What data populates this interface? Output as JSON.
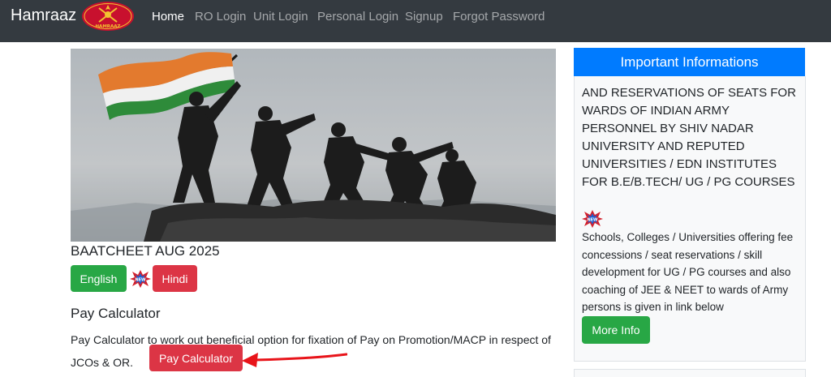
{
  "nav": {
    "brand": "Hamraaz",
    "emblem_text": "HAMRAAZ",
    "links": [
      "Home",
      "RO Login",
      "Unit Login",
      "Personal Login",
      "Signup",
      "Forgot Password"
    ]
  },
  "main": {
    "section_title": "BAATCHEET AUG 2025",
    "english_label": "English",
    "hindi_label": "Hindi",
    "pay_title": "Pay Calculator",
    "pay_desc": "Pay Calculator to work out beneficial option for fixation of Pay on Promotion/MACP in respect of JCOs & OR.",
    "pay_button": "Pay Calculator"
  },
  "sidebar": {
    "header": "Important Informations",
    "heading": "AND RESERVATIONS OF SEATS FOR WARDS OF INDIAN ARMY PERSONNEL BY SHIV NADAR UNIVERSITY AND REPUTED UNIVERSITIES / EDN INSTITUTES FOR B.E/B.TECH/ UG / PG COURSES",
    "text": "Schools, Colleges / Universities offering fee concessions / seat reservations / skill development for UG / PG courses and also coaching of JEE & NEET to wards of Army persons is given in link below",
    "more_button": "More Info"
  },
  "badge_text": "NEW",
  "colors": {
    "navbar": "#343a40",
    "primary": "#007bff",
    "success": "#28a745",
    "danger": "#dc3545",
    "arrow": "#e8141a"
  }
}
